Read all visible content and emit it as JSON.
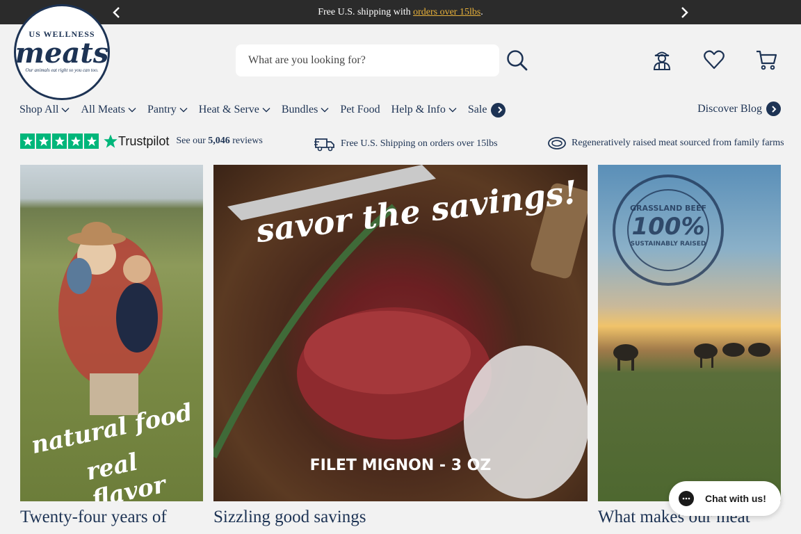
{
  "announcement": {
    "text_before": "Free U.S. shipping with ",
    "link": "orders over 15lbs",
    "text_after": "."
  },
  "logo": {
    "top": "US WELLNESS",
    "main": "meats",
    "sub": "Our animals eat right so you can too."
  },
  "search": {
    "placeholder": "What are you looking for?"
  },
  "nav": {
    "items": [
      {
        "label": "Shop All",
        "dropdown": true
      },
      {
        "label": "All Meats",
        "dropdown": true
      },
      {
        "label": "Pantry",
        "dropdown": true
      },
      {
        "label": "Heat & Serve",
        "dropdown": true
      },
      {
        "label": "Bundles",
        "dropdown": true
      },
      {
        "label": "Pet Food",
        "dropdown": false
      },
      {
        "label": "Help & Info",
        "dropdown": true
      },
      {
        "label": "Sale",
        "dropdown": false
      }
    ],
    "blog": "Discover Blog"
  },
  "trust": {
    "brand": "Trustpilot",
    "text_before": "See our ",
    "count": "5,046",
    "text_after": " reviews"
  },
  "info": {
    "shipping": "Free U.S. Shipping on orders over 15lbs",
    "sourcing": "Regeneratively raised meat sourced from family farms"
  },
  "cards": [
    {
      "title": "Twenty-four years of",
      "overlay1": "natural food",
      "overlay2": "real flavor"
    },
    {
      "title": "Sizzling good savings",
      "overlay1": "savor the savings!",
      "label": "FILET MIGNON - 3 OZ"
    },
    {
      "title": "What makes our meat",
      "badge_top": "GRASSLAND BEEF",
      "badge_num": "100%",
      "badge_sub": "SUSTAINABLY RAISED"
    }
  ],
  "chat": {
    "label": "Chat with us!"
  },
  "colors": {
    "navy": "#1d3354",
    "gold_link": "#e8b13a",
    "trustpilot_green": "#00b67a"
  }
}
